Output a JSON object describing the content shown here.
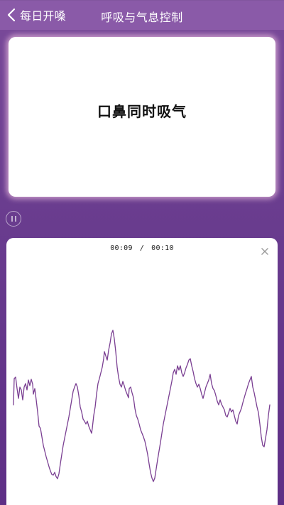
{
  "header": {
    "back_label": "每日开嗓",
    "title": "呼吸与气息控制"
  },
  "instruction": {
    "text": "口鼻同时吸气"
  },
  "player": {
    "elapsed": "00:09",
    "separator": "/",
    "total": "00:10"
  },
  "colors": {
    "header_bg": "#8a5aa8",
    "waveform": "#7a3f92",
    "card_glow": "#e8b9dc"
  }
}
